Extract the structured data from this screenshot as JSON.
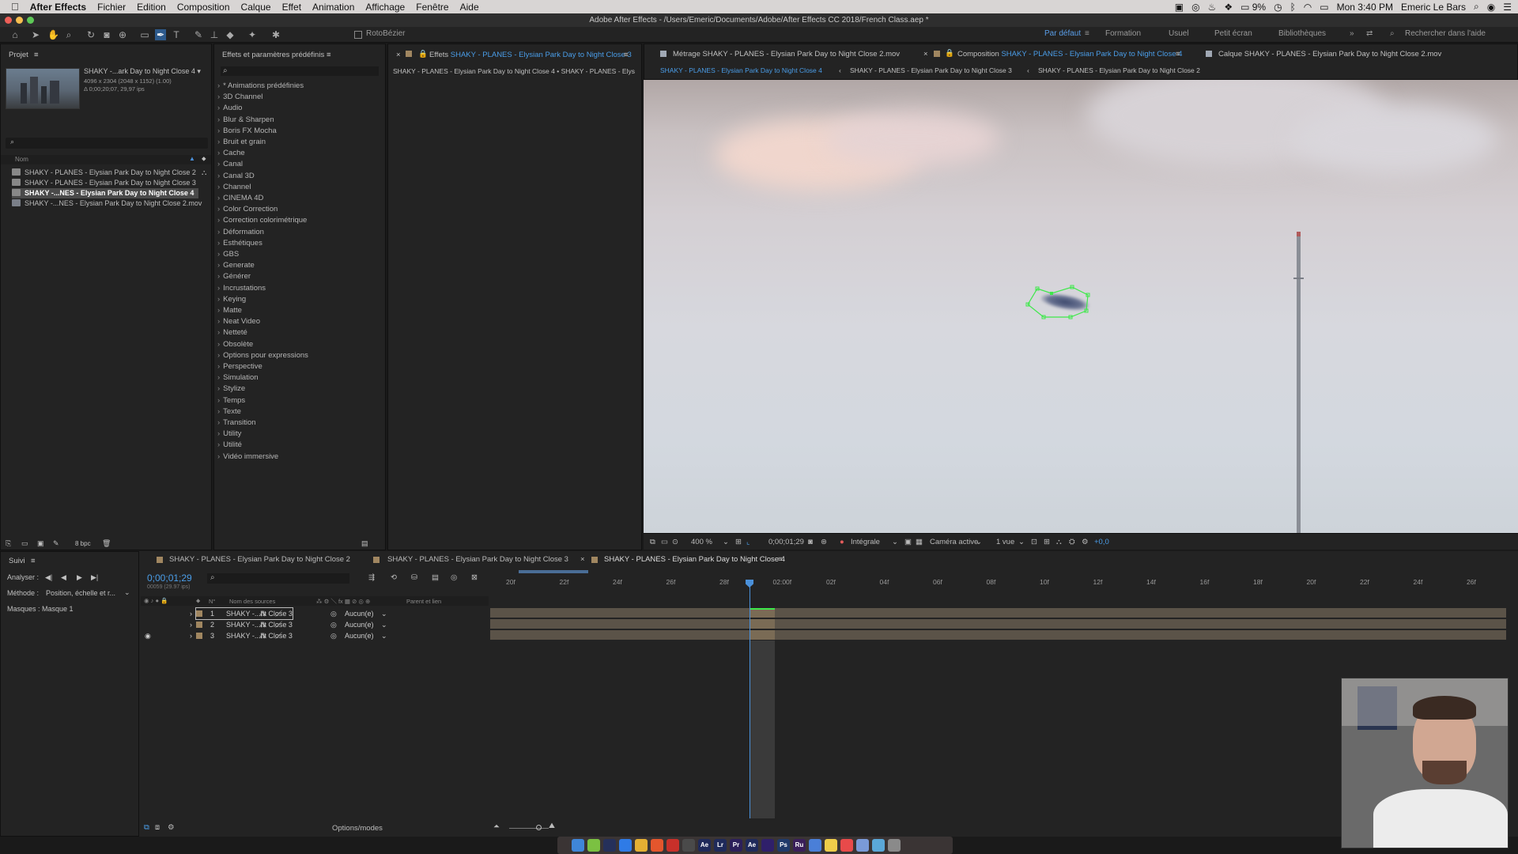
{
  "menubar": {
    "app": "After Effects",
    "items": [
      "Fichier",
      "Edition",
      "Composition",
      "Calque",
      "Effet",
      "Animation",
      "Affichage",
      "Fenêtre",
      "Aide"
    ],
    "battery": "9%",
    "clock": "Mon 3:40 PM",
    "user": "Emeric Le Bars"
  },
  "window_title": "Adobe After Effects - /Users/Emeric/Documents/Adobe/After Effects CC 2018/French Class.aep *",
  "toolbar": {
    "rotobezier": "RotoBézier",
    "workspaces": [
      "Par défaut",
      "Formation",
      "Usuel",
      "Petit écran",
      "Bibliothèques"
    ],
    "search_placeholder": "Rechercher dans l'aide"
  },
  "project_panel": {
    "tab": "Projet",
    "thumb_name": "SHAKY -...ark Day to Night Close 4 ▾",
    "thumb_info1": "4096 x 2304  (2048 x 1152) (1.00)",
    "thumb_info2": "Δ 0;00;20;07, 29,97 ips",
    "col_name": "Nom",
    "items": [
      "SHAKY - PLANES - Elysian Park Day to Night Close 2",
      "SHAKY - PLANES - Elysian Park Day to Night Close 3",
      "SHAKY -...NES - Elysian Park Day to Night Close 4",
      "SHAKY -...NES - Elysian Park Day to Night Close 2.mov"
    ],
    "bpc": "8 bpc"
  },
  "effects_panel": {
    "tab": "Effets et paramètres prédéfinis",
    "categories": [
      "* Animations prédéfinies",
      "3D Channel",
      "Audio",
      "Blur & Sharpen",
      "Boris FX Mocha",
      "Bruit et grain",
      "Cache",
      "Canal",
      "Canal 3D",
      "Channel",
      "CINEMA 4D",
      "Color Correction",
      "Correction colorimétrique",
      "Déformation",
      "Esthétiques",
      "GBS",
      "Generate",
      "Générer",
      "Incrustations",
      "Keying",
      "Matte",
      "Neat Video",
      "Netteté",
      "Obsolète",
      "Options pour expressions",
      "Perspective",
      "Simulation",
      "Stylize",
      "Temps",
      "Texte",
      "Transition",
      "Utility",
      "Utilité",
      "Vidéo immersive"
    ]
  },
  "effect_controls": {
    "tab_prefix": "Effets",
    "tab_name": "SHAKY - PLANES - Elysian Park Day to Night Close 3",
    "path": "SHAKY - PLANES - Elysian Park Day to Night Close 4 • SHAKY - PLANES - Elys"
  },
  "viewer": {
    "tab_footage_prefix": "Métrage",
    "tab_footage": "SHAKY - PLANES - Elysian Park Day to Night Close 2.mov",
    "tab_comp_prefix": "Composition",
    "tab_comp": "SHAKY - PLANES - Elysian Park Day to Night Close 4",
    "tab_layer_prefix": "Calque",
    "tab_layer": "SHAKY - PLANES - Elysian Park Day to Night Close 2.mov",
    "crumbs": [
      "SHAKY - PLANES - Elysian Park Day to Night Close 4",
      "SHAKY - PLANES - Elysian Park Day to Night Close 3",
      "SHAKY - PLANES - Elysian Park Day to Night Close 2"
    ],
    "zoom": "400 %",
    "timecode": "0;00;01;29",
    "resolution": "Intégrale",
    "camera": "Caméra active",
    "views": "1 vue",
    "exposure": "+0,0"
  },
  "tracker": {
    "tab": "Suivi",
    "analyze": "Analyser :",
    "method_label": "Méthode :",
    "method_value": "Position, échelle et r...",
    "masks_label": "Masques :",
    "masks_value": "Masque 1"
  },
  "timeline": {
    "tabs": [
      "SHAKY - PLANES - Elysian Park Day to Night Close 2",
      "SHAKY - PLANES - Elysian Park Day to Night Close 3",
      "SHAKY - PLANES - Elysian Park Day to Night Close 4"
    ],
    "timecode": "0;00;01;29",
    "frames": "00059 (29.97 ips)",
    "col_num": "N°",
    "col_source": "Nom des sources",
    "col_parent": "Parent et lien",
    "layers": [
      {
        "num": "1",
        "name": "SHAKY -...ht Close 3",
        "parent": "Aucun(e)"
      },
      {
        "num": "2",
        "name": "SHAKY -...ht Close 3",
        "parent": "Aucun(e)"
      },
      {
        "num": "3",
        "name": "SHAKY -...ht Close 3",
        "parent": "Aucun(e)"
      }
    ],
    "ruler": [
      "20f",
      "22f",
      "24f",
      "26f",
      "28f",
      "02:00f",
      "02f",
      "04f",
      "06f",
      "08f",
      "10f",
      "12f",
      "14f",
      "16f",
      "18f",
      "20f",
      "22f",
      "24f",
      "26f"
    ],
    "options": "Options/modes"
  },
  "dock_apps": [
    "Finder",
    "Android",
    "Steam",
    "Safari",
    "Chrome",
    "Firefox",
    "Filezilla",
    "Affinity",
    "Ae",
    "Lr",
    "Pr",
    "Ae",
    "Media Encoder",
    "Ps",
    "Ru",
    "Lingo",
    "Notes",
    "Calendar",
    "Preview",
    "Capture",
    "Misc"
  ]
}
